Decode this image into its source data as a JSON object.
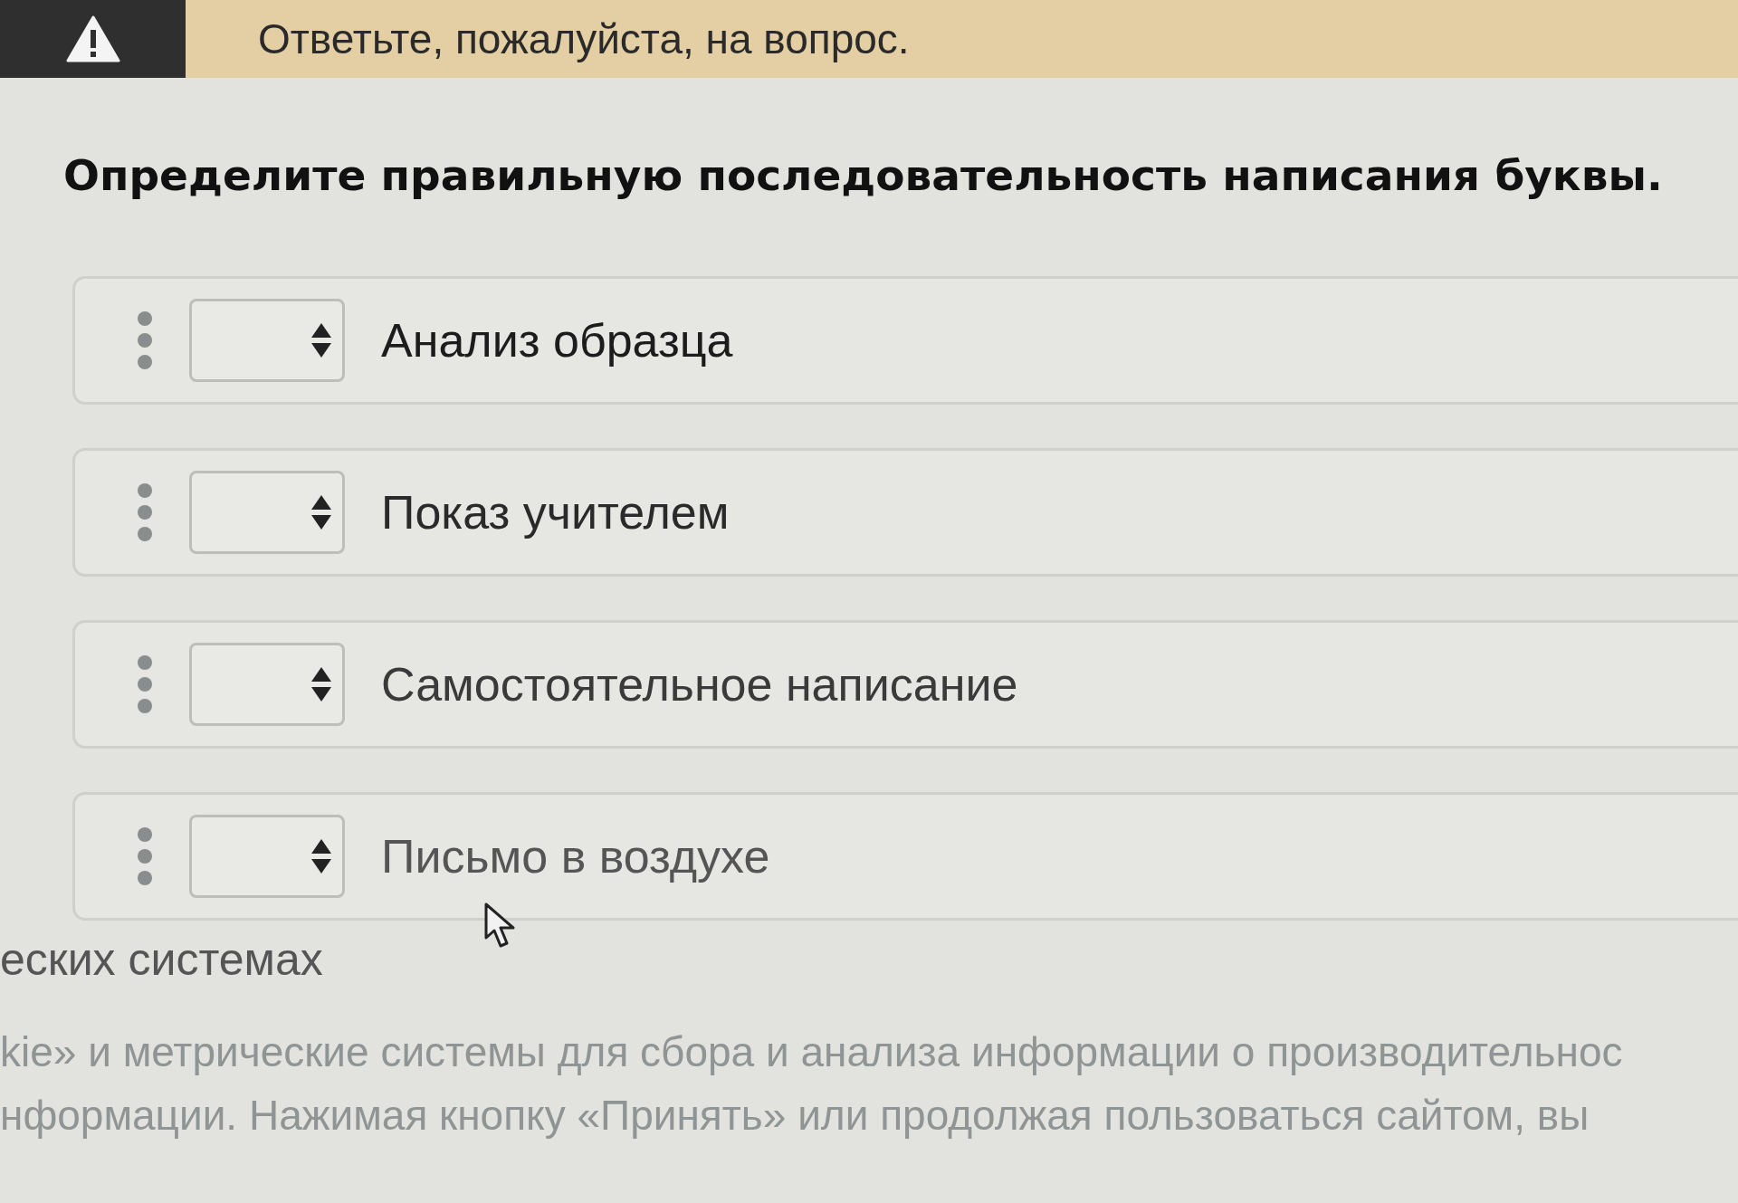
{
  "alert": {
    "message": "Ответьте, пожалуйста, на вопрос."
  },
  "question": {
    "text": "Определите правильную последовательность написания буквы."
  },
  "answers": [
    {
      "label": "Анализ образца"
    },
    {
      "label": "Показ учителем"
    },
    {
      "label": "Самостоятельное написание"
    },
    {
      "label": "Письмо в воздухе"
    }
  ],
  "notice": {
    "heading": "еских системах",
    "lines": [
      "kie» и метрические системы для сбора и анализа информации о производительнос",
      "нформации. Нажимая кнопку «Принять» или продолжая пользоваться сайтом, вы"
    ]
  }
}
